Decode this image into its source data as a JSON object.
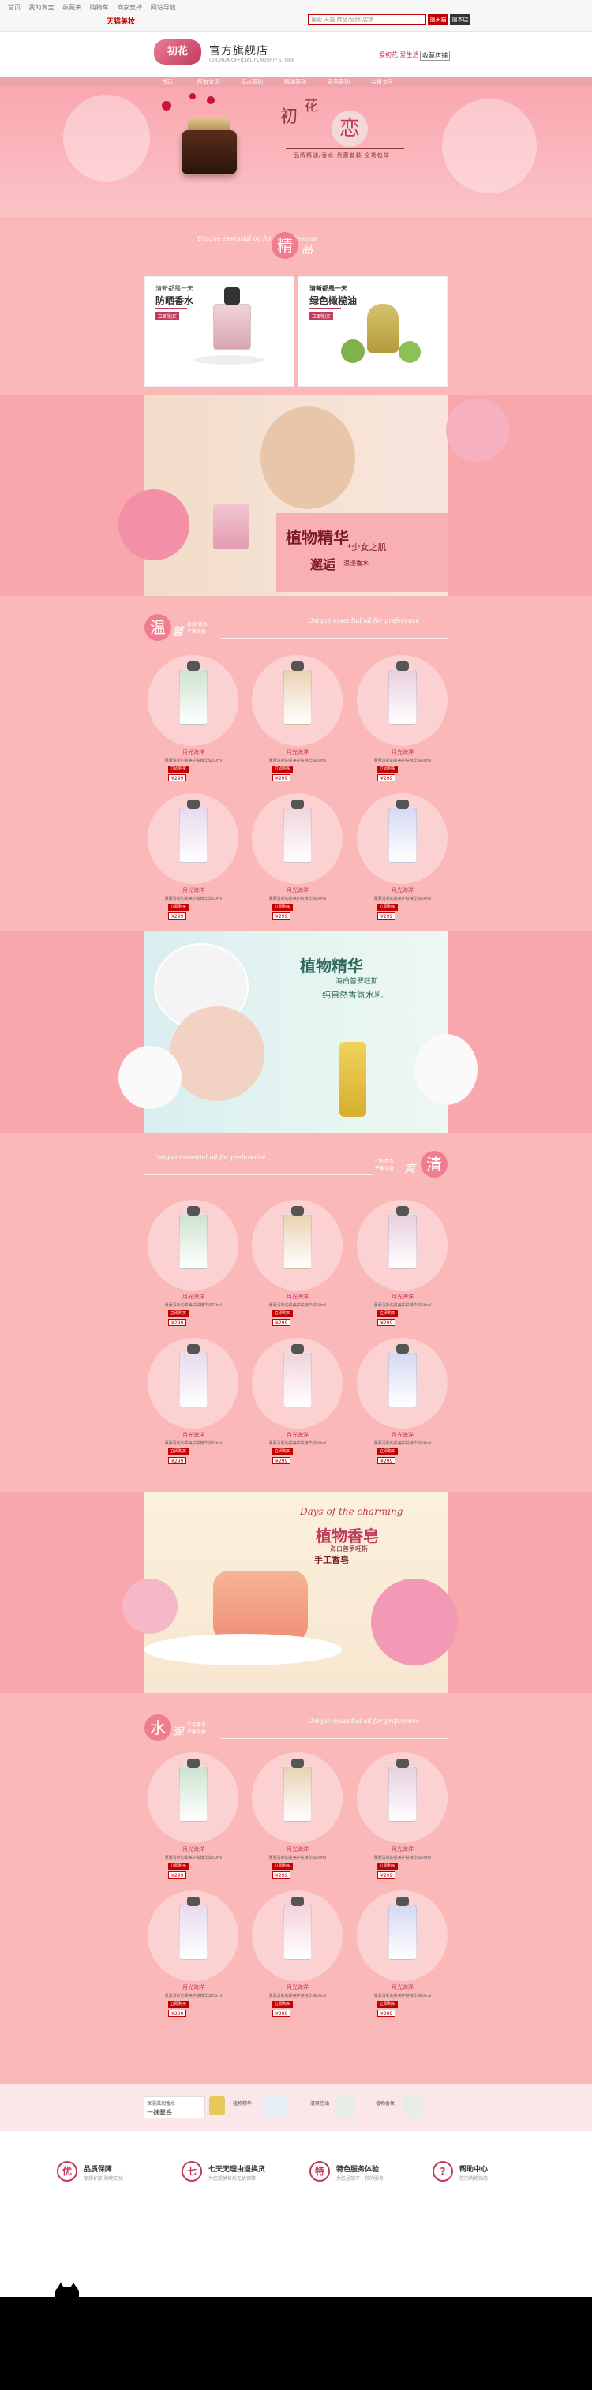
{
  "topbar": {
    "brand": "天猫美妆",
    "links": [
      "首页",
      "我的淘宝",
      "收藏夹",
      "购物车",
      "商家支持",
      "网站导航"
    ],
    "search_placeholder": "搜索 天猫 商品/品牌/店铺",
    "search_button": "搜天猫",
    "search_store_button": "搜本店"
  },
  "header": {
    "logo_text": "初花",
    "store_name": "官方旗舰店",
    "store_sub": "CHUHUA OFFICIAL FLAGSHIP STORE",
    "right_text": "爱初花 爱生活",
    "right_link": "收藏店铺"
  },
  "nav": [
    "首页",
    "所有宝贝",
    "香水系列",
    "精油系列",
    "香皂系列",
    "会员专区"
  ],
  "hero": {
    "title_a": "初",
    "title_b": "花",
    "title_big": "恋",
    "subtitle": "品牌精油/香水 优惠套装 全场包邮"
  },
  "section_jingpin": {
    "script": "Unique essential oil for ... preference",
    "circle": "精",
    "circle_text": "品"
  },
  "feature_cards": [
    {
      "line1": "清新都是一天",
      "title": "防晒香水",
      "button": "立即购买"
    },
    {
      "line1": "清新都是一天",
      "title": "绿色橄榄油",
      "button": "立即购买"
    }
  ],
  "banner1": {
    "title": "植物精华",
    "sub1": "*少女之肌",
    "sub2": "邂逅",
    "sub3": "浪漫香水"
  },
  "section_wen": {
    "circle": "温",
    "label": "馨",
    "sub1": "原液/香水",
    "sub2": "平衡淡香",
    "script": "Unique essential oil for preference"
  },
  "section_qing": {
    "circle": "清",
    "label": "爽",
    "sub1": "七彩香水",
    "sub2": "平衡淡香",
    "script": "Unique essential oil for preference"
  },
  "section_shui": {
    "circle": "水",
    "label": "润",
    "sub1": "手工香皂",
    "sub2": "平衡淡香",
    "script": "Unique essential oil for preference"
  },
  "banner2": {
    "title": "植物精华",
    "sub1": "海白普罗旺斯",
    "sub2": "纯自然香氛水乳"
  },
  "banner3": {
    "script": "Days of the charming",
    "title": "植物香皂",
    "sub1": "海白普罗旺斯",
    "sub2": "手工香皂"
  },
  "products_perfume": [
    {
      "name": "月光海洋",
      "desc": "薰薰清新的柔美护肤精华油50ml",
      "tag": "立即购买",
      "price": "¥299"
    },
    {
      "name": "月光海洋",
      "desc": "薰薰清新的柔美护肤精华油50ml",
      "tag": "立即购买",
      "price": "¥299"
    },
    {
      "name": "月光海洋",
      "desc": "薰薰清新的柔美护肤精华油50ml",
      "tag": "立即购买",
      "price": "¥299"
    },
    {
      "name": "月光海洋",
      "desc": "薰薰清新的柔美护肤精华油50ml",
      "tag": "立即购买",
      "price": "¥299"
    },
    {
      "name": "月光海洋",
      "desc": "薰薰清新的柔美护肤精华油50ml",
      "tag": "立即购买",
      "price": "¥299"
    },
    {
      "name": "月光海洋",
      "desc": "薰薰清新的柔美护肤精华油50ml",
      "tag": "立即购买",
      "price": "¥299"
    }
  ],
  "products_fresh": [
    {
      "name": "月光海洋",
      "desc": "薰薰清新的柔美护肤精华油50ml",
      "tag": "立即购买",
      "price": "¥299"
    },
    {
      "name": "月光海洋",
      "desc": "薰薰清新的柔美护肤精华油50ml",
      "tag": "立即购买",
      "price": "¥299"
    },
    {
      "name": "月光海洋",
      "desc": "薰薰清新的柔美护肤精华油50ml",
      "tag": "立即购买",
      "price": "¥299"
    },
    {
      "name": "月光海洋",
      "desc": "薰薰清新的柔美护肤精华油50ml",
      "tag": "立即购买",
      "price": "¥299"
    },
    {
      "name": "月光海洋",
      "desc": "薰薰清新的柔美护肤精华油50ml",
      "tag": "立即购买",
      "price": "¥299"
    },
    {
      "name": "月光海洋",
      "desc": "薰薰清新的柔美护肤精华油50ml",
      "tag": "立即购买",
      "price": "¥299"
    }
  ],
  "products_soap": [
    {
      "name": "月光海洋",
      "desc": "薰薰清新的柔美护肤精华油50ml",
      "tag": "立即购买",
      "price": "¥299"
    },
    {
      "name": "月光海洋",
      "desc": "薰薰清新的柔美护肤精华油50ml",
      "tag": "立即购买",
      "price": "¥299"
    },
    {
      "name": "月光海洋",
      "desc": "薰薰清新的柔美护肤精华油50ml",
      "tag": "立即购买",
      "price": "¥299"
    },
    {
      "name": "月光海洋",
      "desc": "薰薰清新的柔美护肤精华油50ml",
      "tag": "立即购买",
      "price": "¥299"
    },
    {
      "name": "月光海洋",
      "desc": "薰薰清新的柔美护肤精华油50ml",
      "tag": "立即购买",
      "price": "¥299"
    },
    {
      "name": "月光海洋",
      "desc": "薰薰清新的柔美护肤精华油50ml",
      "tag": "立即购买",
      "price": "¥299"
    }
  ],
  "footer_promo": {
    "left1": "保湿滋润香水",
    "left2": "一抹馨香",
    "item1": "植物精华",
    "item2": "清爽控油",
    "item3": "植物香氛"
  },
  "services": [
    {
      "icon": "优",
      "title": "品质保障",
      "sub": "品质护航 购物无忧"
    },
    {
      "icon": "七",
      "title": "七天无理由退换货",
      "sub": "为您提供售后无忧保障"
    },
    {
      "icon": "特",
      "title": "特色服务体验",
      "sub": "为您呈现不一样的服务"
    },
    {
      "icon": "?",
      "title": "帮助中心",
      "sub": "您的购物指南"
    }
  ],
  "colors": {
    "accent": "#c23b5b",
    "pink": "#fbb8b9",
    "tmall_red": "#c40000"
  }
}
